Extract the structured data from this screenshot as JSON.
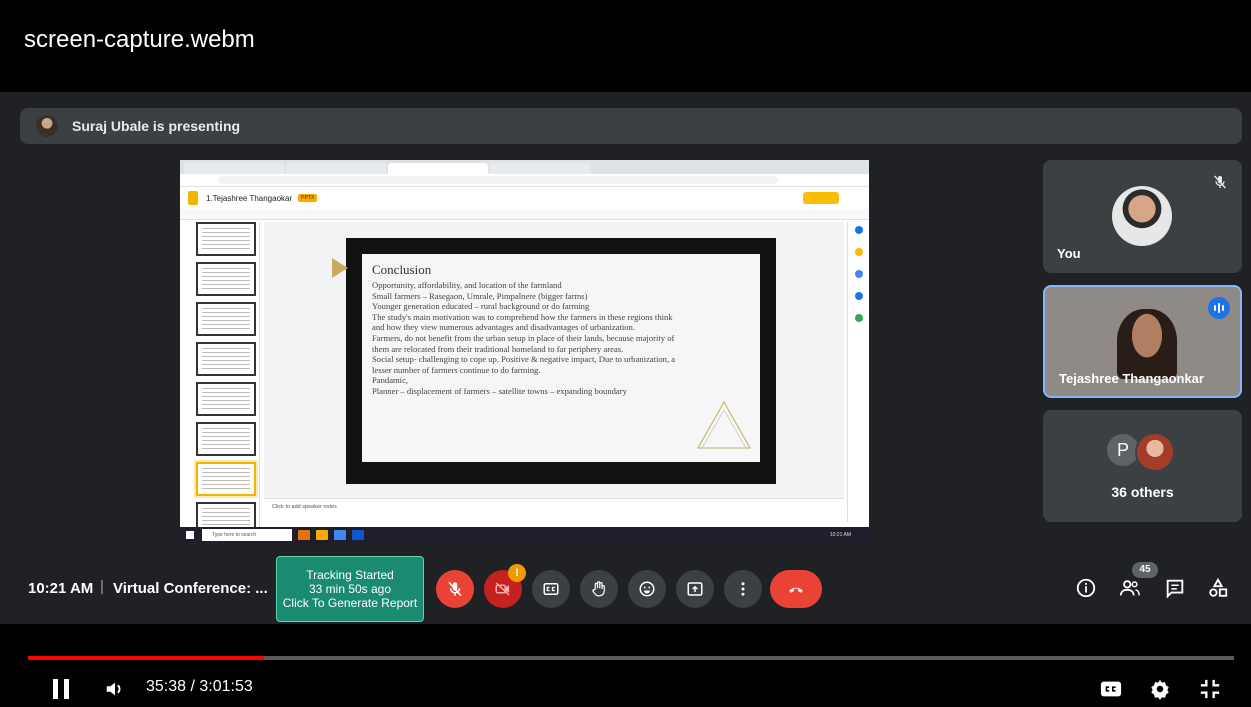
{
  "player": {
    "file_title": "screen-capture.webm",
    "time_display": "35:38 / 3:01:53",
    "progress": 0.196
  },
  "meet": {
    "presenting_text": "Suraj Ubale is presenting",
    "slides_doc_name": "1.Tejashree Thangaokar",
    "slides_badge": "PPTX",
    "speaker_notes": "Click to add speaker notes",
    "taskbar_search": "Type here to search",
    "taskbar_clock": "10:21 AM",
    "slide": {
      "title": "Conclusion",
      "lines": [
        "Opportunity, affordability, and location of the farmland",
        "Small farmers – Rasegaon, Umrale, Pimpalnere (bigger farms)",
        "Younger generation educated – rural background or do farming",
        "The study's main motivation was to comprehend how the farmers in these regions think",
        "and how they view numerous advantages and disadvantages of urbanization.",
        "Farmers, do not benefit from the urban setup in place of their lands, because majority of",
        "them are relocated from their traditional homeland to far periphery areas.",
        "Social setup- challenging to cope up. Positive & negative impact, Due to urbanization, a",
        "lesser number of farmers continue to do farming.",
        "Pandamic,",
        "Planner – displacement of farmers – satellite towns – expanding boundary"
      ]
    },
    "tiles": {
      "you_label": "You",
      "speaker_label": "Tejashree Thangaonkar",
      "others_initial": "P",
      "others_label": "36 others"
    },
    "controls": {
      "clock": "10:21 AM",
      "separator": "|",
      "meeting_title": "Virtual Conference: ...",
      "tracking_line1": "Tracking Started",
      "tracking_line2": "33 min 50s ago",
      "tracking_line3": "Click To Generate Report",
      "camera_badge": "!",
      "participants_count": "45"
    }
  },
  "colors": {
    "meet_bg": "#202124",
    "tile_bg": "#3c4043",
    "danger": "#ea4335",
    "tracking": "#1a8a70",
    "active_speaker": "#8ab4f8",
    "progress": "#ff0000"
  },
  "icons": [
    "mic-off-icon",
    "camera-off-icon",
    "captions-icon",
    "raise-hand-icon",
    "emoji-icon",
    "present-icon",
    "more-icon",
    "hangup-icon",
    "info-icon",
    "people-icon",
    "chat-icon",
    "activities-icon",
    "pause-icon",
    "volume-icon",
    "subtitles-icon",
    "settings-icon",
    "exit-fullscreen-icon"
  ]
}
